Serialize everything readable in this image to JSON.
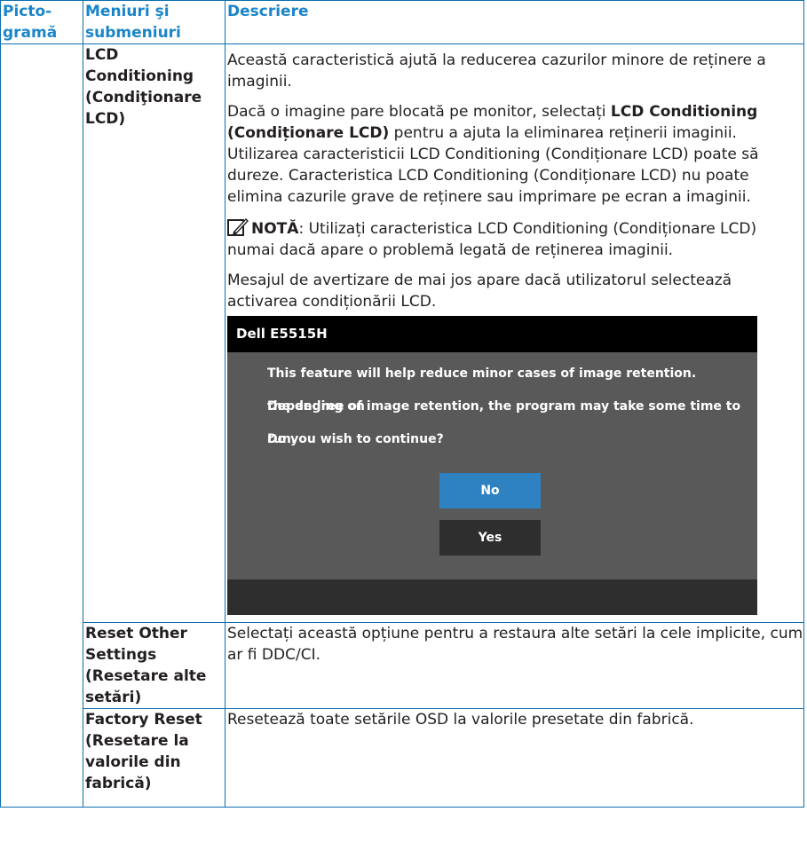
{
  "header": {
    "col1": "Picto-gramă",
    "col2": "Meniuri şi submeniuri",
    "col3": "Descriere"
  },
  "rows": [
    {
      "menu": "LCD Conditioning (Condiţionare LCD)",
      "p1": "Această caracteristică ajută la reducerea cazurilor minore de reținere a imaginii.",
      "p2_pre": "Dacă o imagine pare blocată pe monitor, selectați ",
      "p2_bold": "LCD Conditioning (Condiționare LCD)",
      "p2_post": " pentru a ajuta la eliminarea reținerii imaginii. Utilizarea caracteristicii LCD Conditioning (Condiționare LCD) poate să dureze. Caracteristica LCD Conditioning (Condiționare LCD) nu poate elimina cazurile grave de reținere sau imprimare pe ecran a imaginii.",
      "note_label": "NOTĂ",
      "note_text": ": Utilizați caracteristica LCD Conditioning (Condiționare LCD) numai dacă apare o problemă legată de reținerea imaginii.",
      "p4": "Mesajul de avertizare de mai jos apare dacă utilizatorul selectează activarea condiționării LCD."
    },
    {
      "menu": "Reset Other Settings (Resetare alte setări)",
      "desc": "Selectați această opțiune pentru a restaura alte setări la cele implicite, cum ar fi DDC/CI."
    },
    {
      "menu": "Factory Reset (Resetare la valorile din fabrică)",
      "desc": "Resetează toate setările OSD la valorile presetate din fabrică."
    }
  ],
  "osd": {
    "title": "Dell E5515H",
    "line1": "This feature will help reduce minor cases of image retention. Depending on",
    "line2": "the degree of image retention, the program may take some time to run.",
    "line3": "Do you wish to continue?",
    "no_label": "No",
    "yes_label": "Yes",
    "colors": {
      "title_bar": "#000000",
      "body": "#595959",
      "no_button": "#2f82c2",
      "yes_button": "#2e2e2e"
    }
  },
  "colors": {
    "border": "#0d6fae",
    "header_text": "#1a85c8"
  },
  "icons": {
    "note": "pencil-note-icon"
  }
}
